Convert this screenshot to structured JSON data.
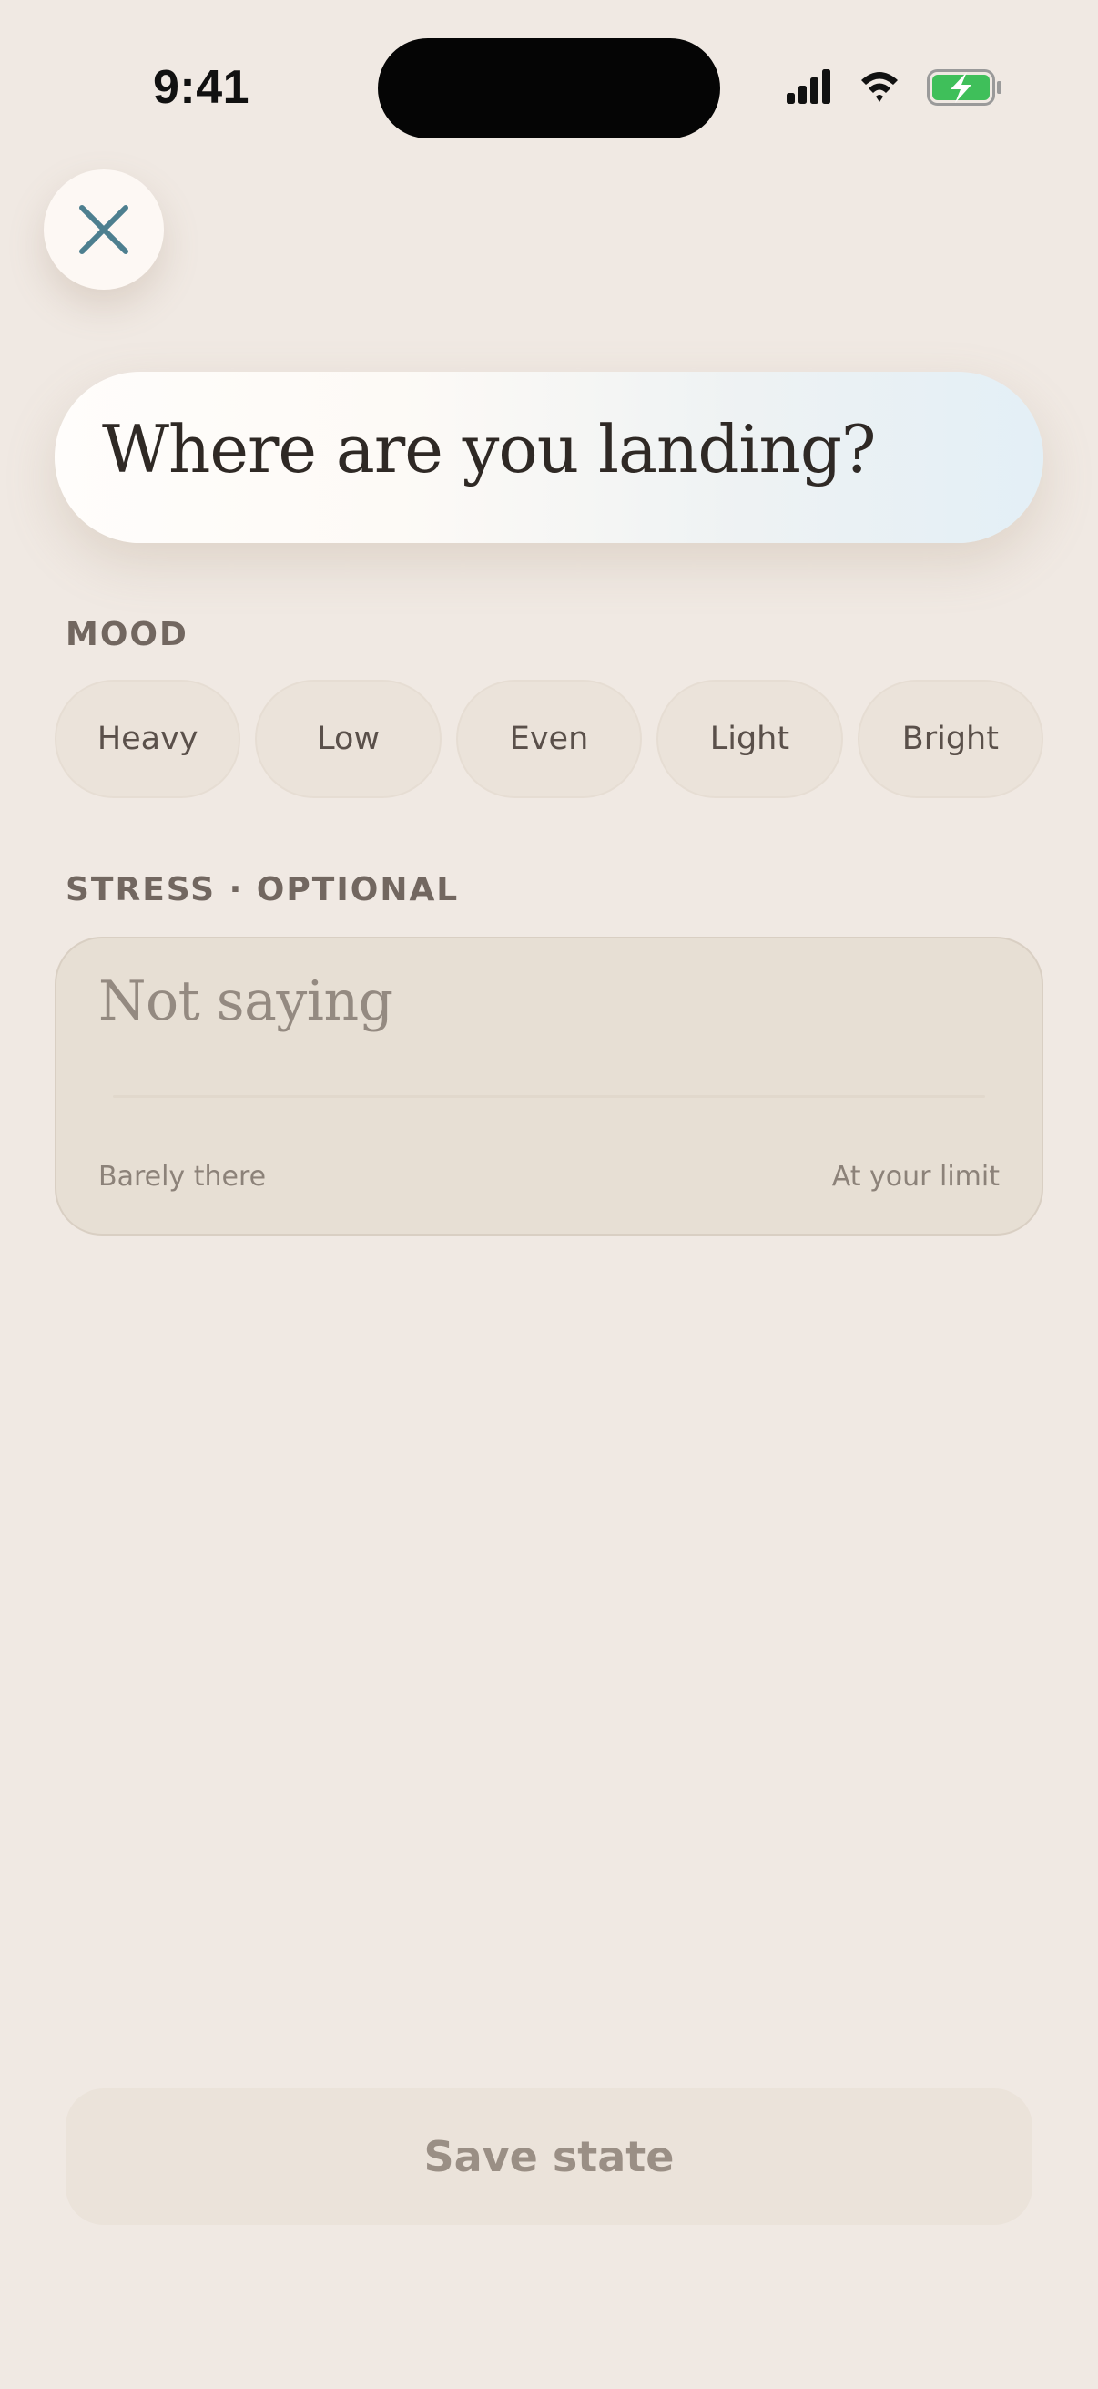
{
  "status_bar": {
    "time": "9:41",
    "icons": [
      "signal-icon",
      "wifi-icon",
      "battery-charging-icon"
    ],
    "battery_color": "#3fbf5a"
  },
  "close_button": {
    "icon": "close-icon",
    "icon_color": "#4d7f8f"
  },
  "header": {
    "title": "Where are you landing?"
  },
  "mood": {
    "label": "MOOD",
    "options": [
      "Heavy",
      "Low",
      "Even",
      "Light",
      "Bright"
    ]
  },
  "stress": {
    "label": "STRESS · OPTIONAL",
    "value": "Not saying",
    "min_label": "Barely there",
    "max_label": "At your limit"
  },
  "footer": {
    "save_label": "Save state"
  },
  "colors": {
    "background": "#f0e9e3",
    "accent": "#4d7f8f"
  }
}
